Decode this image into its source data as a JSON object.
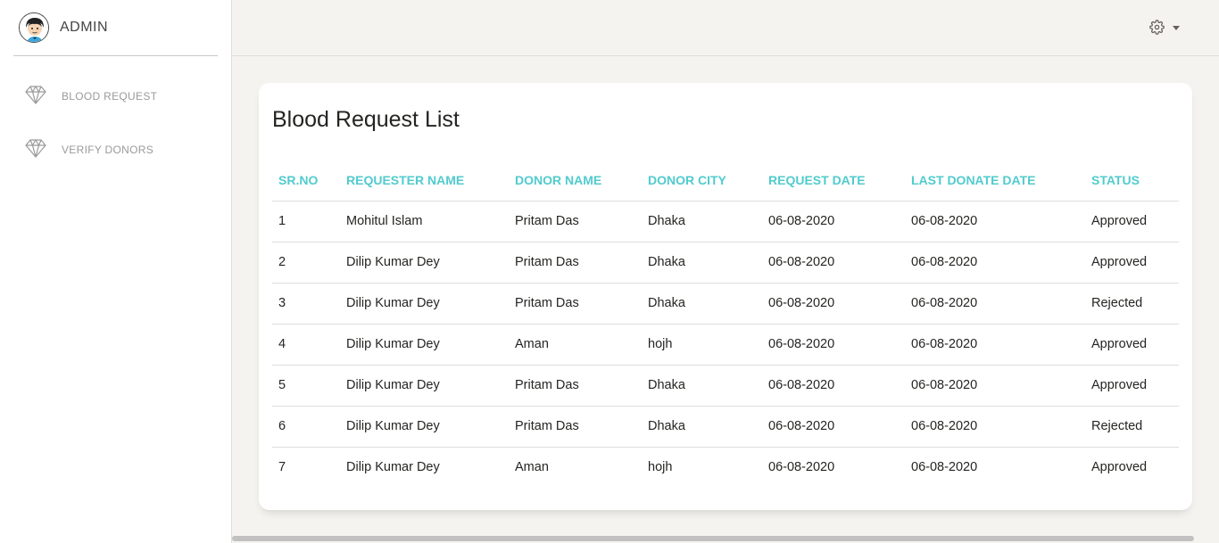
{
  "sidebar": {
    "brand": "ADMIN",
    "items": [
      {
        "label": "BLOOD REQUEST",
        "icon": "diamond-icon"
      },
      {
        "label": "VERIFY DONORS",
        "icon": "diamond-icon"
      }
    ]
  },
  "topbar": {
    "settings_icon": "gear-icon",
    "dropdown_icon": "caret-down-icon"
  },
  "main": {
    "title": "Blood Request List",
    "table": {
      "headers": [
        "SR.NO",
        "REQUESTER NAME",
        "DONOR NAME",
        "DONOR CITY",
        "REQUEST DATE",
        "LAST DONATE DATE",
        "STATUS"
      ],
      "rows": [
        [
          "1",
          "Mohitul Islam",
          "Pritam Das",
          "Dhaka",
          "06-08-2020",
          "06-08-2020",
          "Approved"
        ],
        [
          "2",
          "Dilip Kumar Dey",
          "Pritam Das",
          "Dhaka",
          "06-08-2020",
          "06-08-2020",
          "Approved"
        ],
        [
          "3",
          "Dilip Kumar Dey",
          "Pritam Das",
          "Dhaka",
          "06-08-2020",
          "06-08-2020",
          "Rejected"
        ],
        [
          "4",
          "Dilip Kumar Dey",
          "Aman",
          "hojh",
          "06-08-2020",
          "06-08-2020",
          "Approved"
        ],
        [
          "5",
          "Dilip Kumar Dey",
          "Pritam Das",
          "Dhaka",
          "06-08-2020",
          "06-08-2020",
          "Approved"
        ],
        [
          "6",
          "Dilip Kumar Dey",
          "Pritam Das",
          "Dhaka",
          "06-08-2020",
          "06-08-2020",
          "Rejected"
        ],
        [
          "7",
          "Dilip Kumar Dey",
          "Aman",
          "hojh",
          "06-08-2020",
          "06-08-2020",
          "Approved"
        ]
      ]
    }
  },
  "colors": {
    "accent": "#51cbce",
    "background": "#f4f3ef"
  }
}
